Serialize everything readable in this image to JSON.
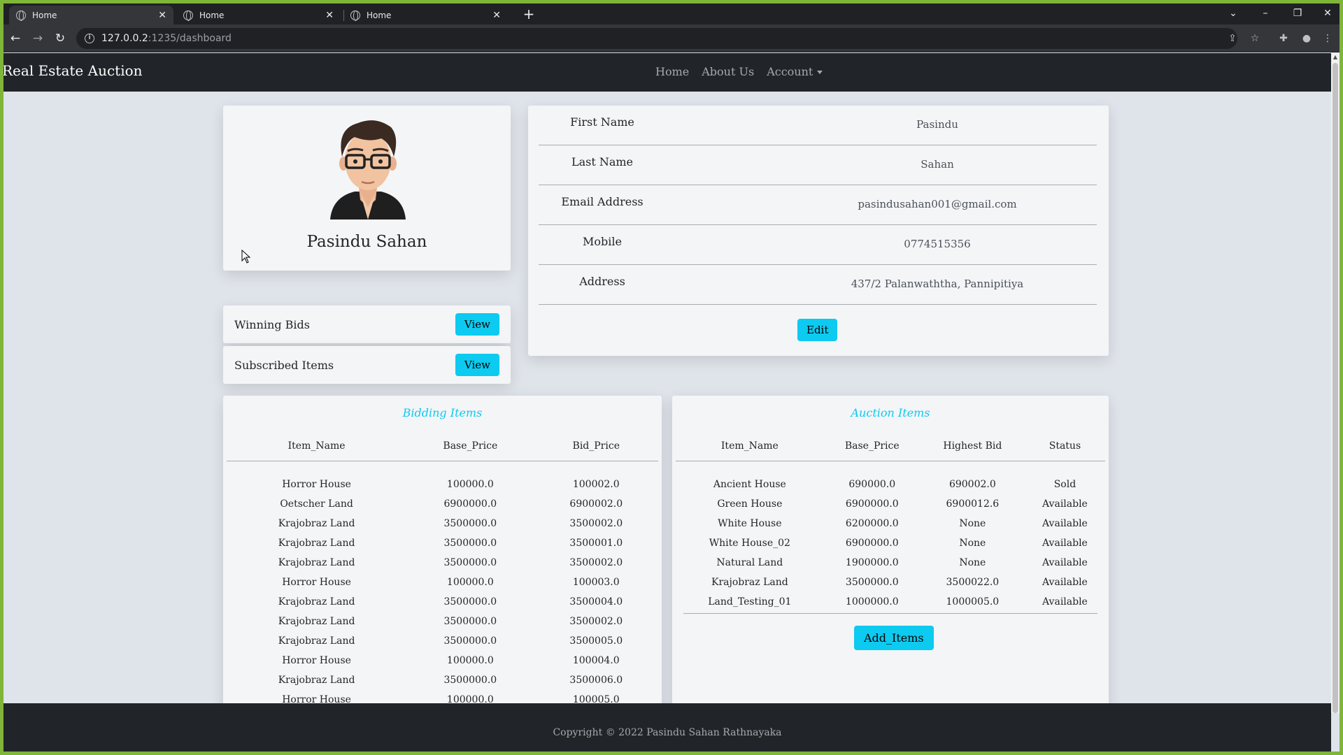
{
  "browser": {
    "tabs": [
      {
        "title": "Home",
        "active": true
      },
      {
        "title": "Home",
        "active": false
      },
      {
        "title": "Home",
        "active": false
      }
    ],
    "url_host": "127.0.0.2",
    "url_path": ":1235/dashboard"
  },
  "site": {
    "brand": "Real Estate Auction",
    "nav": {
      "home": "Home",
      "about": "About Us",
      "account": "Account"
    }
  },
  "profile": {
    "name": "Pasindu Sahan",
    "avatar_icon": "avatar-man-glasses-icon"
  },
  "quick_links": [
    {
      "label": "Winning Bids",
      "button": "View"
    },
    {
      "label": "Subscribed Items",
      "button": "View"
    }
  ],
  "details": [
    {
      "label": "First Name",
      "value": "Pasindu"
    },
    {
      "label": "Last Name",
      "value": "Sahan"
    },
    {
      "label": "Email Address",
      "value": "pasindusahan001@gmail.com"
    },
    {
      "label": "Mobile",
      "value": "0774515356"
    },
    {
      "label": "Address",
      "value": "437/2 Palanwaththa, Pannipitiya"
    }
  ],
  "edit_label": "Edit",
  "bidding": {
    "caption": "Bidding Items",
    "columns": [
      "Item_Name",
      "Base_Price",
      "Bid_Price"
    ],
    "rows": [
      [
        "Horror House",
        "100000.0",
        "100002.0"
      ],
      [
        "Oetscher Land",
        "6900000.0",
        "6900002.0"
      ],
      [
        "Krajobraz Land",
        "3500000.0",
        "3500002.0"
      ],
      [
        "Krajobraz Land",
        "3500000.0",
        "3500001.0"
      ],
      [
        "Krajobraz Land",
        "3500000.0",
        "3500002.0"
      ],
      [
        "Horror House",
        "100000.0",
        "100003.0"
      ],
      [
        "Krajobraz Land",
        "3500000.0",
        "3500004.0"
      ],
      [
        "Krajobraz Land",
        "3500000.0",
        "3500002.0"
      ],
      [
        "Krajobraz Land",
        "3500000.0",
        "3500005.0"
      ],
      [
        "Horror House",
        "100000.0",
        "100004.0"
      ],
      [
        "Krajobraz Land",
        "3500000.0",
        "3500006.0"
      ],
      [
        "Horror House",
        "100000.0",
        "100005.0"
      ]
    ]
  },
  "auction": {
    "caption": "Auction Items",
    "columns": [
      "Item_Name",
      "Base_Price",
      "Highest Bid",
      "Status"
    ],
    "rows": [
      [
        "Ancient House",
        "690000.0",
        "690002.0",
        "Sold"
      ],
      [
        "Green House",
        "6900000.0",
        "6900012.6",
        "Available"
      ],
      [
        "White House",
        "6200000.0",
        "None",
        "Available"
      ],
      [
        "White House_02",
        "6900000.0",
        "None",
        "Available"
      ],
      [
        "Natural Land",
        "1900000.0",
        "None",
        "Available"
      ],
      [
        "Krajobraz Land",
        "3500000.0",
        "3500022.0",
        "Available"
      ],
      [
        "Land_Testing_01",
        "1000000.0",
        "1000005.0",
        "Available"
      ]
    ],
    "add_label": "Add_Items"
  },
  "footer": "Copyright © 2022 Pasindu Sahan Rathnayaka",
  "colors": {
    "accent": "#0dcaf0",
    "navbar": "#212529",
    "page_bg": "#dfe3ea"
  }
}
